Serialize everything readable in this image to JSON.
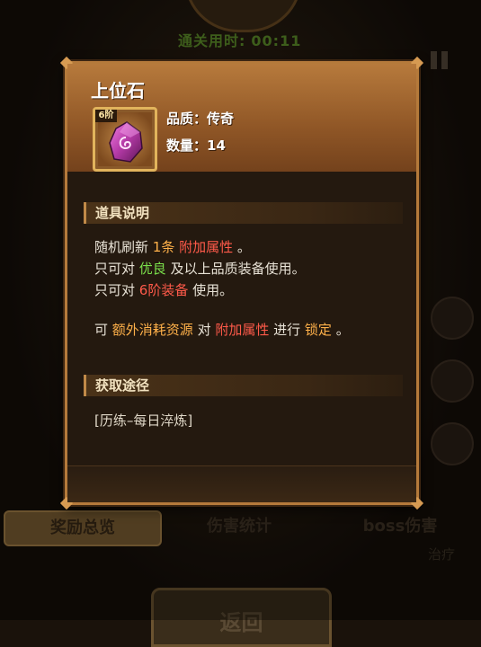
{
  "hud": {
    "timer_label": "通关用时:",
    "timer_value": "00:11"
  },
  "tabs": [
    {
      "label": "奖励总览",
      "active": true
    },
    {
      "label": "伤害统计",
      "active": false
    },
    {
      "label": "boss伤害",
      "active": false
    }
  ],
  "side_label": "治疗",
  "return_label": "返回",
  "popup": {
    "item_name": "上位石",
    "tier_badge": "6阶",
    "quality_label": "品质：",
    "quality_value": "传奇",
    "quantity_label": "数量：",
    "quantity_value": "14",
    "section_desc_title": "道具说明",
    "desc_lines": [
      [
        {
          "t": "随机刷新 ",
          "c": ""
        },
        {
          "t": "1条",
          "c": "orange"
        },
        {
          "t": " ",
          "c": ""
        },
        {
          "t": "附加属性",
          "c": "red"
        },
        {
          "t": " 。",
          "c": ""
        }
      ],
      [
        {
          "t": "只可对 ",
          "c": ""
        },
        {
          "t": "优良",
          "c": "green"
        },
        {
          "t": " 及以上品质装备使用。",
          "c": ""
        }
      ],
      [
        {
          "t": "只可对 ",
          "c": ""
        },
        {
          "t": "6阶装备",
          "c": "red"
        },
        {
          "t": " 使用。",
          "c": ""
        }
      ],
      [
        {
          "t": "可 ",
          "c": ""
        },
        {
          "t": "额外消耗资源",
          "c": "orange"
        },
        {
          "t": " 对 ",
          "c": ""
        },
        {
          "t": "附加属性",
          "c": "red"
        },
        {
          "t": " 进行 ",
          "c": ""
        },
        {
          "t": "锁定",
          "c": "orange"
        },
        {
          "t": " 。",
          "c": ""
        }
      ]
    ],
    "section_source_title": "获取途径",
    "source_text": "[历练–每日淬炼]"
  },
  "colors": {
    "highlight_orange": "#ffb14a",
    "highlight_red": "#ff5a4a",
    "highlight_green": "#7be04b",
    "popup_border": "#b57a3b"
  },
  "icons": {
    "item": "purple-rune-gem-icon",
    "pause": "pause-icon"
  }
}
